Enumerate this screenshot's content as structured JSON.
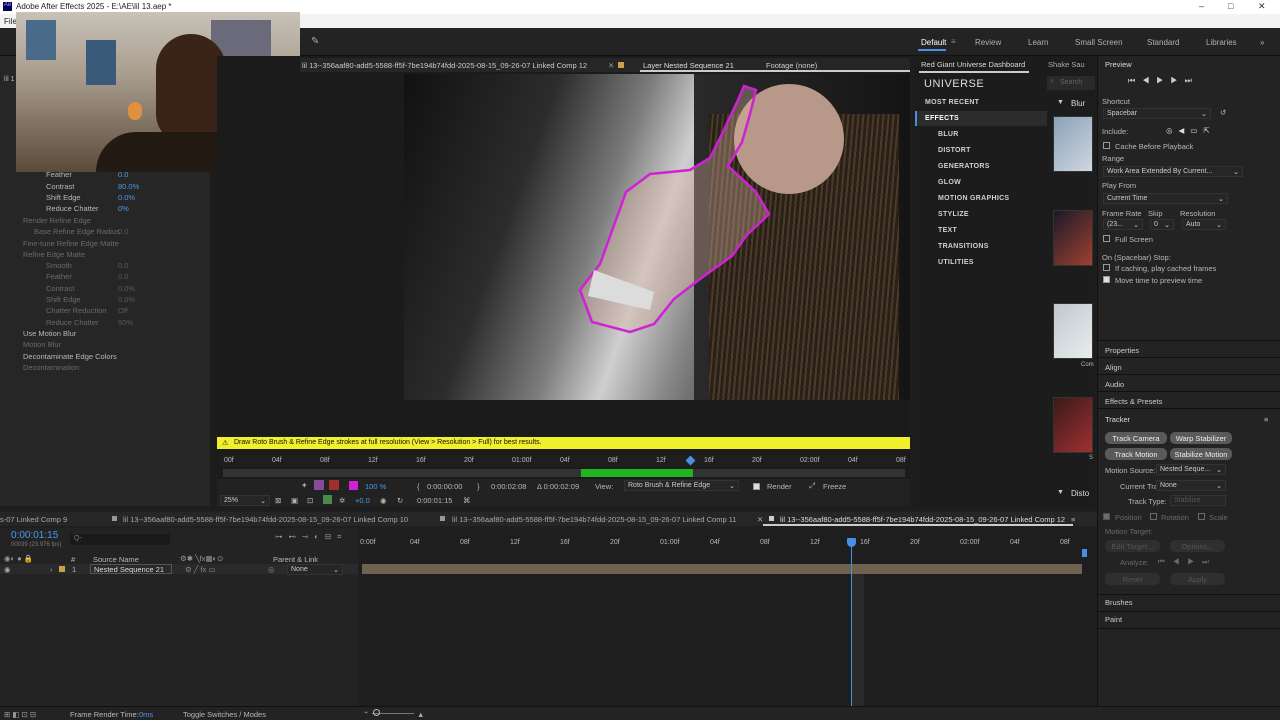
{
  "window": {
    "title": "Adobe After Effects 2025 - E:\\AE\\lil 13.aep *",
    "minimize": "–",
    "maximize": "□",
    "close": "✕"
  },
  "menu": {
    "file": "File"
  },
  "workspaces": [
    "Default",
    "Review",
    "Learn",
    "Small Screen",
    "Standard",
    "Libraries"
  ],
  "left_panel": {
    "lil": "lil 1",
    "props": [
      {
        "label": "Feather",
        "value": "0.0",
        "dim": false
      },
      {
        "label": "Contrast",
        "value": "80.0%",
        "dim": false
      },
      {
        "label": "Shift Edge",
        "value": "0.0%",
        "dim": false
      },
      {
        "label": "Reduce Chatter",
        "value": "0%",
        "dim": false
      },
      {
        "label": "Render Refine Edge",
        "value": "",
        "dim": true
      },
      {
        "label": "Base Refine Edge Radius",
        "value": "0.0",
        "dim": true
      },
      {
        "label": "Fine-tune Refine Edge Matte",
        "value": "",
        "dim": true
      },
      {
        "label": "Refine Edge Matte",
        "value": "",
        "dim": true
      },
      {
        "label": "Smooth",
        "value": "0.0",
        "dim": true
      },
      {
        "label": "Feather",
        "value": "0.0",
        "dim": true
      },
      {
        "label": "Contrast",
        "value": "0.0%",
        "dim": true
      },
      {
        "label": "Shift Edge",
        "value": "0.0%",
        "dim": true
      },
      {
        "label": "Chatter Reduction",
        "value": "Off",
        "dim": true
      },
      {
        "label": "Reduce Chatter",
        "value": "50%",
        "dim": true
      },
      {
        "label": "Use Motion Blur",
        "value": "",
        "dim": false
      },
      {
        "label": "Motion Blur",
        "value": "",
        "dim": true
      },
      {
        "label": "Decontaminate Edge Colors",
        "value": "",
        "dim": false
      },
      {
        "label": "Decontamination",
        "value": "",
        "dim": true
      }
    ]
  },
  "viewer": {
    "tab_comp": "lil 13--356aaf80-add5-5588-ff5f-7be194b74fdd-2025-08-15_09-26-07 Linked Comp 12",
    "tab_layer": "Layer Nested Sequence 21",
    "tab_footage": "Footage (none)",
    "warning": "Draw Roto Brush & Refine Edge strokes at full resolution (View > Resolution > Full) for best results.",
    "ruler": [
      "00f",
      "04f",
      "08f",
      "12f",
      "16f",
      "20f",
      "01:00f",
      "04f",
      "08f",
      "12f",
      "16f",
      "20f",
      "02:00f",
      "04f",
      "08f"
    ],
    "zoom": "25%",
    "opacity": "100 %",
    "in_time": "0:00:00:00",
    "out_time": "0:00:02:08",
    "duration": "Δ 0:00:02:09",
    "view_label": "View:",
    "view_value": "Roto Brush & Refine Edge",
    "render_label": "Render",
    "freeze_label": "Freeze",
    "offset": "+0.0",
    "current_time": "0:00:01:15"
  },
  "universe": {
    "tab_dashboard": "Red Giant Universe Dashboard",
    "tab_shake": "Shake Sau",
    "search": "Search",
    "brand": "UNIVERSE",
    "most_recent": "MOST RECENT",
    "effects": "EFFECTS",
    "categories": [
      "BLUR",
      "DISTORT",
      "GENERATORS",
      "GLOW",
      "MOTION GRAPHICS",
      "STYLIZE",
      "TEXT",
      "TRANSITIONS",
      "UTILITIES"
    ],
    "blur_header": "Blur",
    "disto_header": "Disto",
    "thumb_labels": [
      "Com",
      "S"
    ]
  },
  "preview": {
    "title": "Preview",
    "shortcut_label": "Shortcut",
    "shortcut_value": "Spacebar",
    "include_label": "Include:",
    "cache_label": "Cache Before Playback",
    "range_label": "Range",
    "range_value": "Work Area Extended By Current...",
    "play_from_label": "Play From",
    "play_from_value": "Current Time",
    "frame_rate_label": "Frame Rate",
    "frame_rate_value": "(23...",
    "skip_label": "Skip",
    "skip_value": "0",
    "resolution_label": "Resolution",
    "resolution_value": "Auto",
    "full_screen_label": "Full Screen",
    "on_stop_label": "On (Spacebar) Stop:",
    "if_caching_label": "If caching, play cached frames",
    "move_time_label": "Move time to preview time"
  },
  "panels": {
    "properties": "Properties",
    "align": "Align",
    "audio": "Audio",
    "effects_presets": "Effects & Presets",
    "tracker": "Tracker",
    "brushes": "Brushes",
    "paint": "Paint"
  },
  "tracker": {
    "track_camera": "Track Camera",
    "warp_stabilizer": "Warp Stabilizer",
    "track_motion": "Track Motion",
    "stabilize_motion": "Stabilize Motion",
    "motion_source_label": "Motion Source:",
    "motion_source_value": "Nested Seque...",
    "current_track_label": "Current Track:",
    "current_track_value": "None",
    "track_type_label": "Track Type:",
    "track_type_value": "Stabilize",
    "position": "Position",
    "rotation": "Rotation",
    "scale": "Scale",
    "motion_target": "Motion Target:",
    "edit_target": "Edit Target...",
    "options": "Options...",
    "analyze": "Analyze:",
    "reset": "Reset",
    "apply": "Apply"
  },
  "timeline": {
    "tabs": [
      "lil 13--356aaf80-add5-5588-ff5f-7be194b74fdd-2025-08-15_09-26-07 Linked Comp 9",
      "lil 13--356aaf80-add5-5588-ff5f-7be194b74fdd-2025-08-15_09-26-07 Linked Comp 10",
      "lil 13--356aaf80-add5-5588-ff5f-7be194b74fdd-2025-08-15_09-26-07 Linked Comp 11",
      "lil 13--356aaf80-add5-5588-ff5f-7be194b74fdd-2025-08-15_09-26-07 Linked Comp 12"
    ],
    "tab_prefix_9": "s-07 Linked Comp 9",
    "current_time": "0:00:01:15",
    "fps": "00039 (23.976 fps)",
    "search_placeholder": "Q-",
    "source_name_header": "Source Name",
    "parent_header": "Parent & Link",
    "layer_number": "1",
    "layer_name": "Nested Sequence 21",
    "parent_value": "None",
    "ruler": [
      "0:00f",
      "04f",
      "08f",
      "12f",
      "16f",
      "20f",
      "01:00f",
      "04f",
      "08f",
      "12f",
      "16f",
      "20f",
      "02:00f",
      "04f",
      "08f"
    ]
  },
  "status": {
    "frame_render_label": "Frame Render Time:",
    "frame_render_value": "0ms",
    "toggle": "Toggle Switches / Modes"
  },
  "colors": {
    "accent": "#4a90e2",
    "warning": "#f0f02d",
    "roto_outline": "#d020d8",
    "work_area": "#1fb51f"
  }
}
